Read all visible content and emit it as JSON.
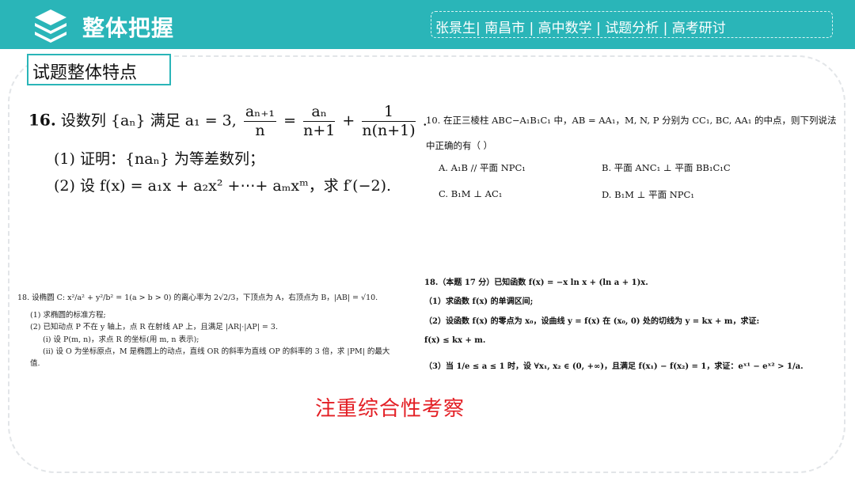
{
  "header": {
    "title": "整体把握",
    "tagline": "张景生| 南昌市  |  高中数学  |  试题分析  |  高考研讨",
    "bg_color": "#2ab5b8",
    "logo_icon": "stacked-layers-icon"
  },
  "section_label": "试题整体特点",
  "q16": {
    "number": "16.",
    "stem_prefix": "设数列",
    "seq": "{aₙ}",
    "stem_mid": "满足 a₁ = 3,",
    "f1_num": "aₙ₊₁",
    "f1_den": "n",
    "eq": "=",
    "f2_num": "aₙ",
    "f2_den": "n+1",
    "plus": "+",
    "f3_num": "1",
    "f3_den": "n(n+1)",
    "end": ".",
    "part1": "(1) 证明：{naₙ} 为等差数列；",
    "part2": "(2) 设 f(x) = a₁x + a₂x² +⋯+ aₘxᵐ，求 f′(−2)."
  },
  "q10": {
    "stem": "10. 在正三棱柱 ABC−A₁B₁C₁ 中，AB = AA₁，M, N, P 分别为 CC₁, BC, AA₁ 的中点，则下列说法",
    "stem2": "中正确的有（    ）",
    "optA": "A.  A₁B // 平面 NPC₁",
    "optB": "B.  平面 ANC₁ ⊥ 平面 BB₁C₁C",
    "optC": "C.  B₁M ⊥ AC₁",
    "optD": "D.  B₁M ⊥ 平面 NPC₁"
  },
  "q18a": {
    "line1": "18. 设椭圆 C: x²/a² + y²/b² = 1(a > b > 0) 的离心率为 2√2/3，下顶点为 A，右顶点为 B，|AB| = √10.",
    "line2": "(1) 求椭圆的标准方程;",
    "line3": "(2) 已知动点 P 不在 y 轴上，点 R 在射线 AP 上，且满足 |AR|·|AP| = 3.",
    "line4": "(i) 设 P(m, n)，求点 R 的坐标(用 m, n 表示);",
    "line5": "(ii) 设 O 为坐标原点，M 是椭圆上的动点，直线 OR 的斜率为直线 OP 的斜率的 3 倍，求 |PM| 的最大",
    "line6": "值."
  },
  "q18b": {
    "line1": "18.（本题 17 分）已知函数 f(x) = −x ln x + (ln a + 1)x.",
    "line2": "（1）求函数 f(x) 的单调区间;",
    "line3": "（2）设函数 f(x) 的零点为 x₀，设曲线 y = f(x) 在 (x₀, 0) 处的切线为 y = kx + m，求证:",
    "line4": "f(x) ≤ kx + m.",
    "line5": "（3）当 1/e ≤ a ≤ 1 时，设 ∀x₁, x₂ ∈ (0, +∞)，且满足 f(x₁) − f(x₂) = 1，求证：eˣ¹ − eˣ² > 1/a."
  },
  "note": "注重综合性考察",
  "note_color": "#e31e24"
}
